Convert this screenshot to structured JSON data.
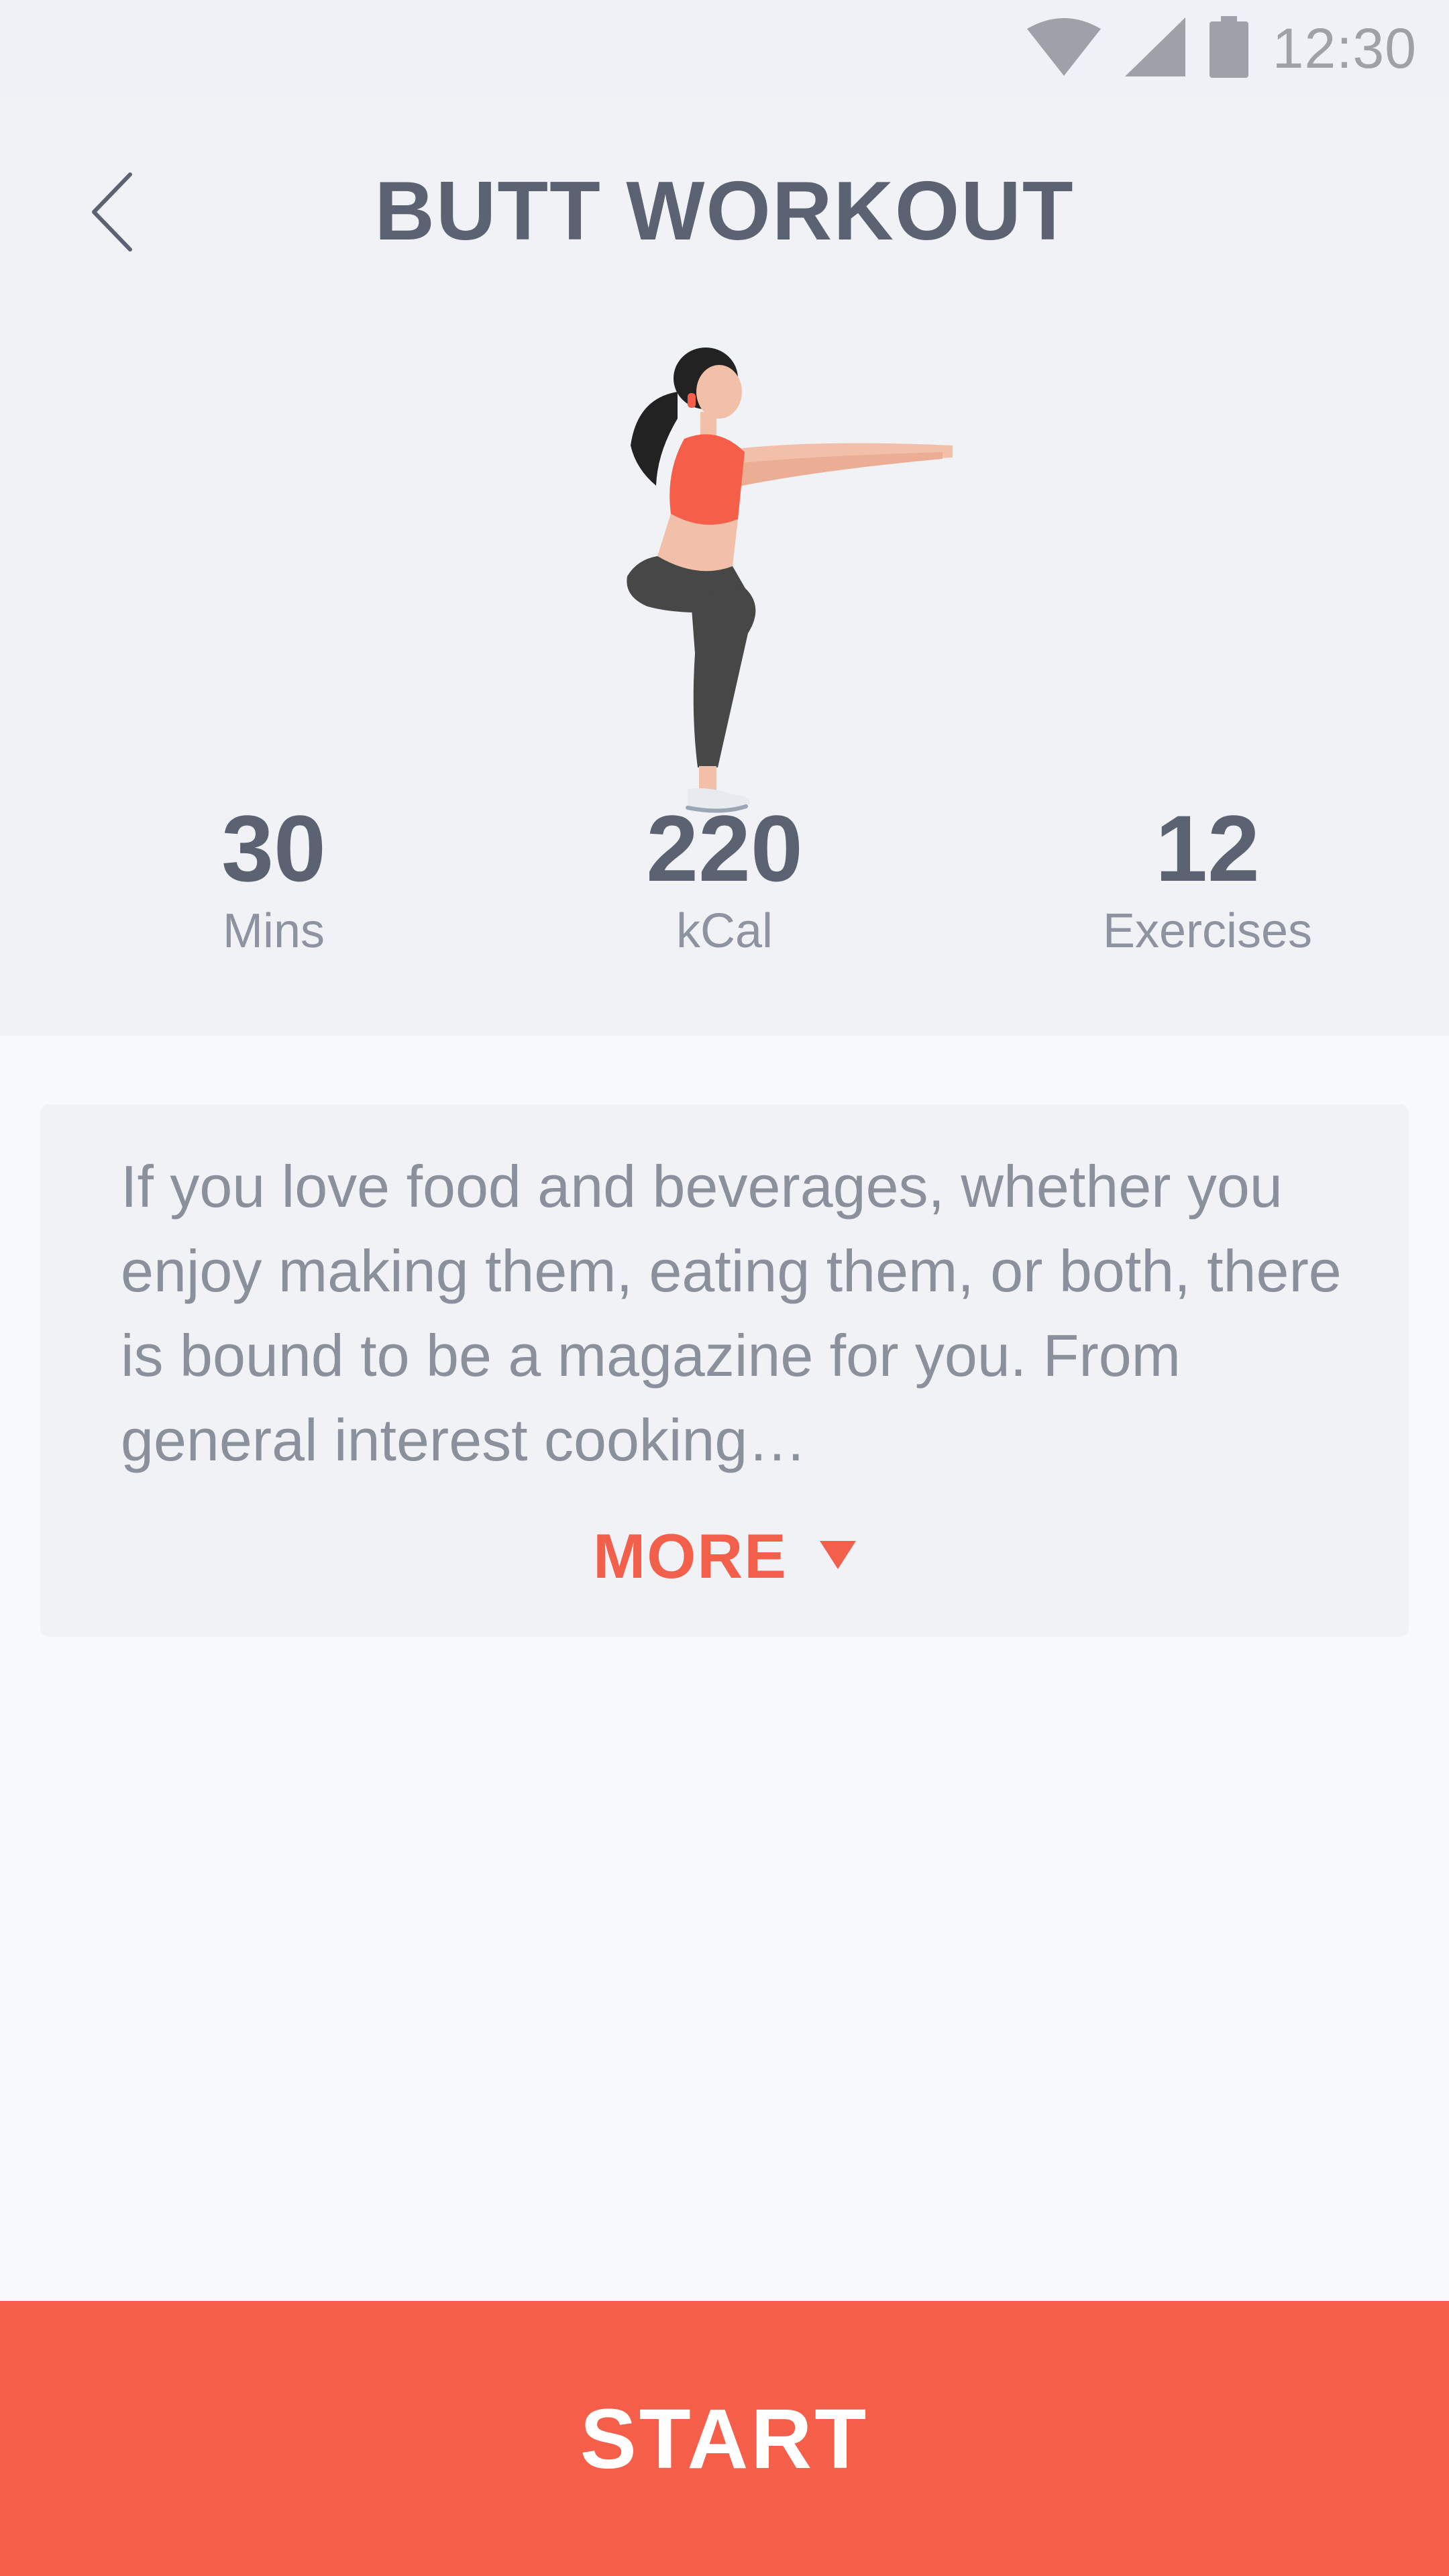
{
  "status_bar": {
    "time": "12:30",
    "icons": [
      "wifi-icon",
      "cell-signal-icon",
      "battery-icon"
    ]
  },
  "header": {
    "title": "BUTT WORKOUT",
    "back_icon": "chevron-left-icon",
    "illustration": "woman-squat-illustration"
  },
  "stats": [
    {
      "value": "30",
      "label": "Mins"
    },
    {
      "value": "220",
      "label": "kCal"
    },
    {
      "value": "12",
      "label": "Exercises"
    }
  ],
  "description": {
    "text": "If you love food and beverages, whether you enjoy making them, eating them, or both, there is bound to be a magazine for you. From general interest cooking…",
    "more_label": "MORE",
    "more_icon": "caret-down-icon"
  },
  "start_button": {
    "label": "START"
  },
  "colors": {
    "accent": "#f55f4a",
    "text_dark": "#5b6372",
    "text_muted": "#8a909c",
    "header_bg": "#f1f2f5",
    "page_bg": "#f7f9fd"
  }
}
